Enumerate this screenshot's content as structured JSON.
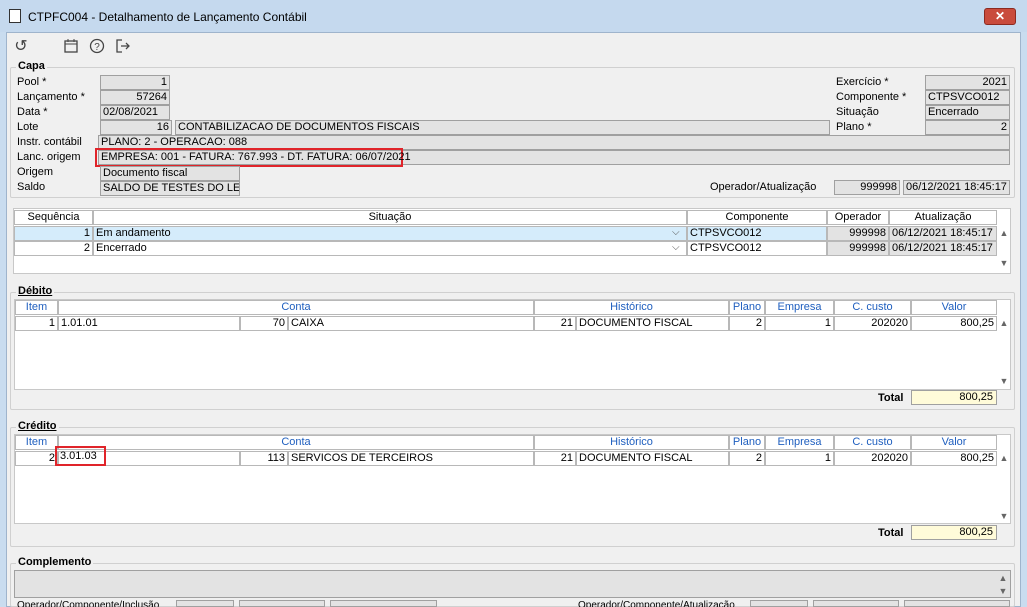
{
  "window": {
    "title": "CTPFC004 - Detalhamento de Lançamento Contábil",
    "close": "✕"
  },
  "toolbar": {
    "undo": "↺",
    "calendar": "▦",
    "help": "?",
    "exit": "⇥"
  },
  "capa": {
    "label": "Capa",
    "pool_label": "Pool *",
    "pool": "1",
    "lancamento_label": "Lançamento *",
    "lancamento": "57264",
    "data_label": "Data *",
    "data": "02/08/2021",
    "lote_label": "Lote",
    "lote": "16",
    "lote_desc": "CONTABILIZACAO DE DOCUMENTOS FISCAIS",
    "instr_label": "Instr. contábil",
    "instr": "PLANO: 2 - OPERACAO: 088",
    "lanc_origem_label": "Lanc. origem",
    "lanc_origem": "EMPRESA: 001 - FATURA: 767.993 - DT. FATURA: 06/07/2021",
    "origem_label": "Origem",
    "origem": "Documento fiscal",
    "saldo_label": "Saldo",
    "saldo": "SALDO DE TESTES DO LEO",
    "exercicio_label": "Exercício *",
    "exercicio": "2021",
    "componente_label": "Componente *",
    "componente": "CTPSVCO012",
    "situacao_label": "Situação",
    "situacao": "Encerrado",
    "plano_label": "Plano *",
    "plano": "2",
    "operador_label": "Operador/Atualização",
    "operador": "999998",
    "atualizacao": "06/12/2021 18:45:17"
  },
  "sequencia": {
    "headers": [
      "Sequência",
      "Situação",
      "Componente",
      "Operador",
      "Atualização"
    ],
    "rows": [
      {
        "seq": "1",
        "situacao": "Em andamento",
        "componente": "CTPSVCO012",
        "operador": "999998",
        "atualizacao": "06/12/2021 18:45:17"
      },
      {
        "seq": "2",
        "situacao": "Encerrado",
        "componente": "CTPSVCO012",
        "operador": "999998",
        "atualizacao": "06/12/2021 18:45:17"
      }
    ]
  },
  "debito": {
    "label": "Débito",
    "headers": [
      "Item",
      "Conta",
      "Histórico",
      "Plano",
      "Empresa",
      "C. custo",
      "Valor"
    ],
    "rows": [
      {
        "item": "1",
        "conta": "1.01.01",
        "conta_num": "70",
        "conta_desc": "CAIXA",
        "hist_num": "21",
        "hist_desc": "DOCUMENTO FISCAL",
        "plano": "2",
        "empresa": "1",
        "ccusto": "202020",
        "valor": "800,25"
      }
    ],
    "total_label": "Total",
    "total": "800,25"
  },
  "credito": {
    "label": "Crédito",
    "headers": [
      "Item",
      "Conta",
      "Histórico",
      "Plano",
      "Empresa",
      "C. custo",
      "Valor"
    ],
    "rows": [
      {
        "item": "2",
        "conta": "3.01.03",
        "conta_num": "113",
        "conta_desc": "SERVICOS DE TERCEIROS",
        "hist_num": "21",
        "hist_desc": "DOCUMENTO FISCAL",
        "plano": "2",
        "empresa": "1",
        "ccusto": "202020",
        "valor": "800,25"
      }
    ],
    "total_label": "Total",
    "total": "800,25"
  },
  "complemento": {
    "label": "Complemento",
    "incl_label": "Operador/Componente/Inclusão",
    "atual_label": "Operador/Componente/Atualização"
  }
}
